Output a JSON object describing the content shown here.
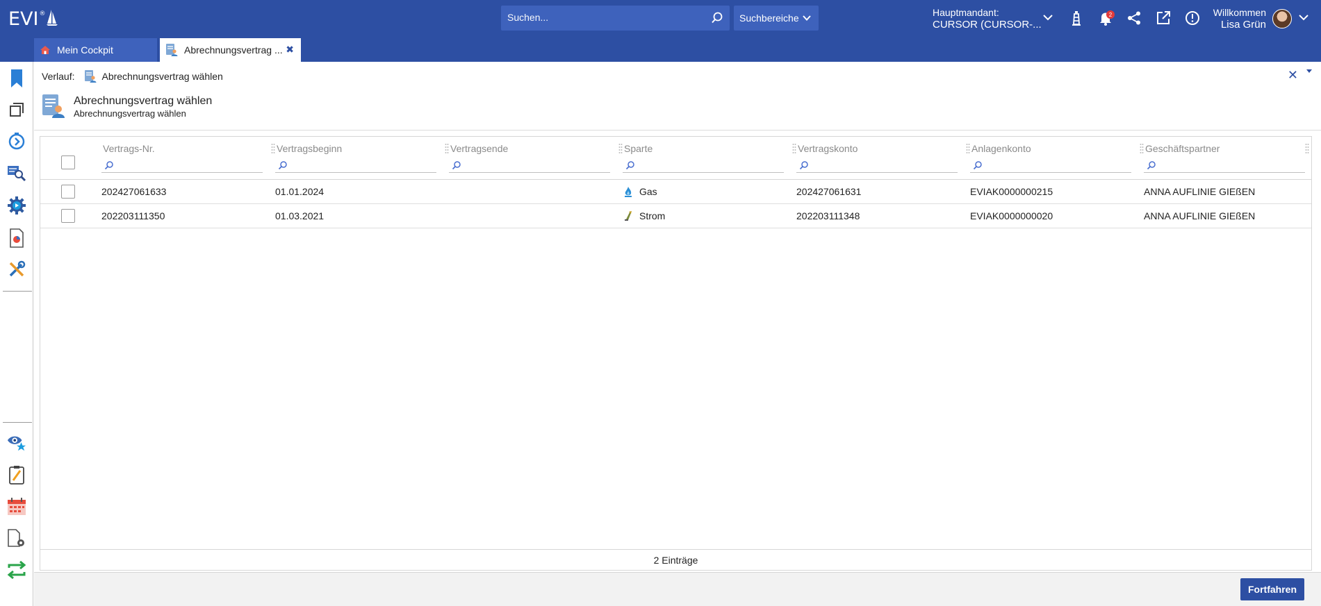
{
  "header": {
    "logo_text": "EVI",
    "logo_mark": "®",
    "search": {
      "placeholder": "Suchen..."
    },
    "search_scope_label": "Suchbereiche",
    "mandant_label": "Hauptmandant:",
    "mandant_value": "CURSOR (CURSOR-...",
    "notification_count": "2",
    "welcome_label": "Willkommen",
    "user_name": "Lisa Grün",
    "icons": [
      "lighthouse-icon",
      "bell-icon",
      "share-icon",
      "external-link-icon",
      "info-icon"
    ]
  },
  "tabs": [
    {
      "label": "Mein Cockpit",
      "icon": "home-icon",
      "active": false
    },
    {
      "label": "Abrechnungsvertrag ...",
      "icon": "contract-icon",
      "active": true
    }
  ],
  "sidebar": {
    "top_icons": [
      "bookmark-icon",
      "windows-icon",
      "history-icon",
      "search-document-icon",
      "process-gear-icon",
      "report-icon",
      "tools-icon"
    ],
    "bottom_icons": [
      "watchlist-icon",
      "notes-icon",
      "calendar-icon",
      "document-settings-icon",
      "exchange-icon"
    ]
  },
  "history": {
    "label": "Verlauf:",
    "item": "Abrechnungsvertrag wählen"
  },
  "page": {
    "title": "Abrechnungsvertrag wählen",
    "subtitle": "Abrechnungsvertrag wählen"
  },
  "table": {
    "columns": [
      "Vertrags-Nr.",
      "Vertragsbeginn",
      "Vertragsende",
      "Sparte",
      "Vertragskonto",
      "Anlagenkonto",
      "Geschäftspartner"
    ],
    "rows": [
      {
        "vertrags_nr": "202427061633",
        "beginn": "01.01.2024",
        "ende": "",
        "sparte": "Gas",
        "sparte_icon": "flame-icon",
        "konto": "202427061631",
        "anlagenkonto": "EVIAK0000000215",
        "partner": "ANNA AUFLINIE GIEßEN"
      },
      {
        "vertrags_nr": "202203111350",
        "beginn": "01.03.2021",
        "ende": "",
        "sparte": "Strom",
        "sparte_icon": "plug-icon",
        "konto": "202203111348",
        "anlagenkonto": "EVIAK0000000020",
        "partner": "ANNA AUFLINIE GIEßEN"
      }
    ],
    "footer": "2 Einträge"
  },
  "actions": {
    "continue_label": "Fortfahren"
  },
  "colors": {
    "primary": "#2d4fa3",
    "header_field": "#3e62bc",
    "badge": "#e23b3b"
  }
}
